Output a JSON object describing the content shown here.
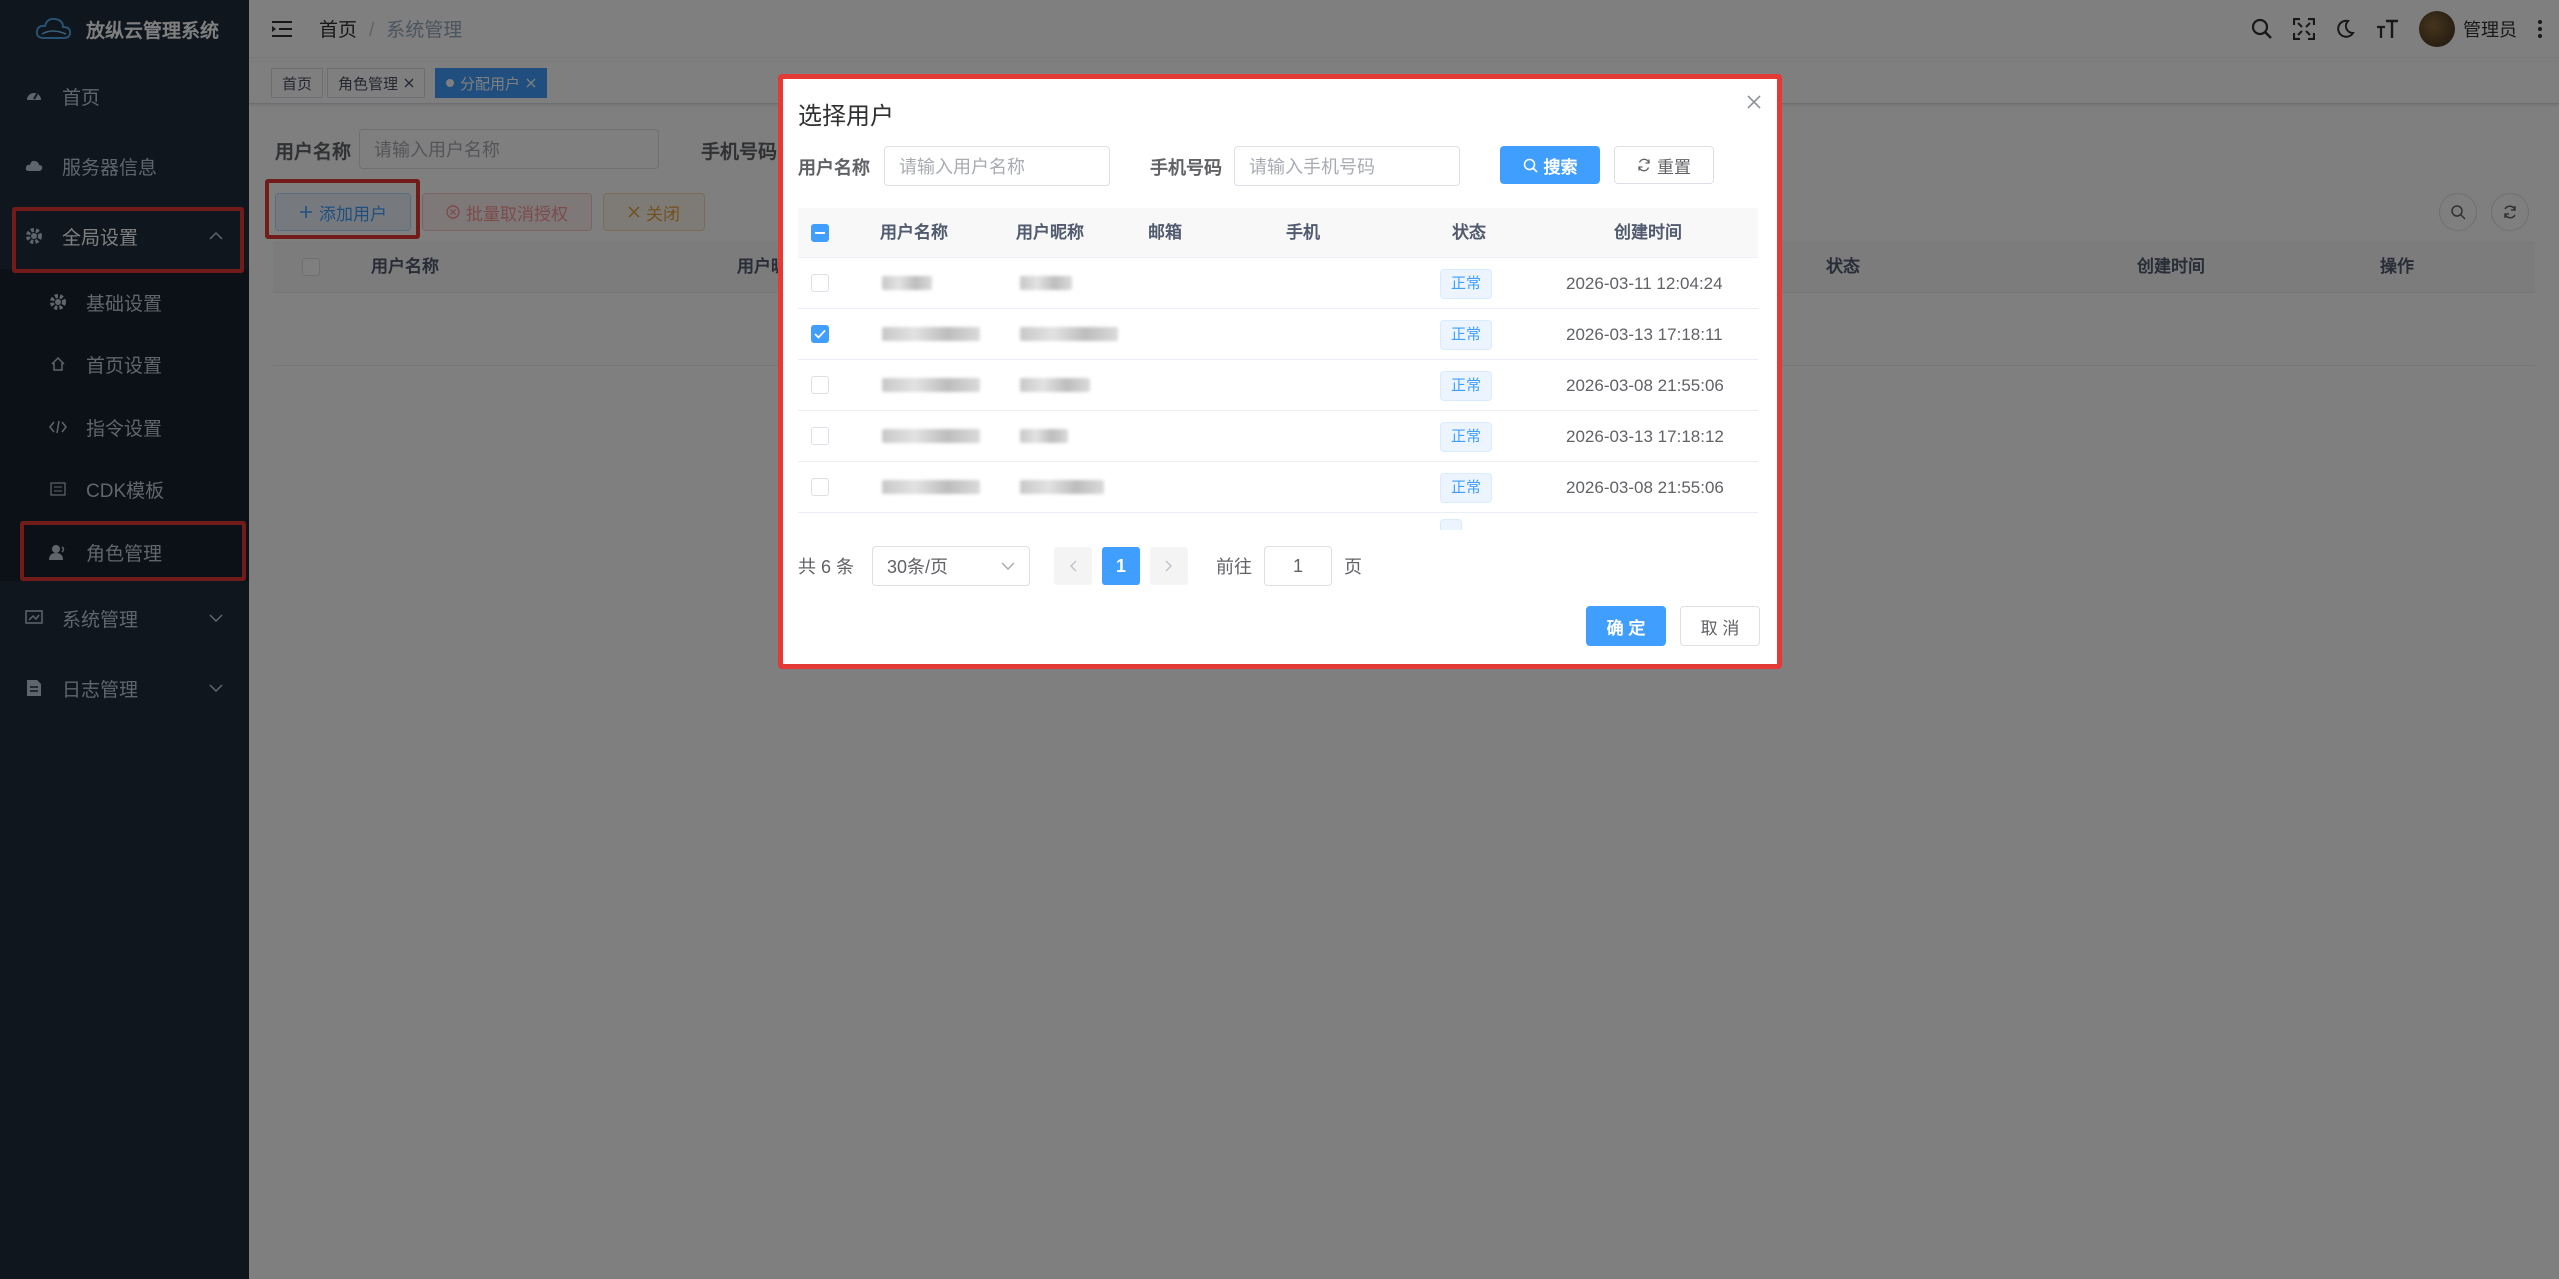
{
  "app": {
    "title": "放纵云管理系统"
  },
  "sidebar": {
    "items": [
      {
        "label": "首页"
      },
      {
        "label": "服务器信息"
      },
      {
        "label": "全局设置"
      },
      {
        "label": "基础设置"
      },
      {
        "label": "首页设置"
      },
      {
        "label": "指令设置"
      },
      {
        "label": "CDK模板"
      },
      {
        "label": "角色管理"
      },
      {
        "label": "系统管理"
      },
      {
        "label": "日志管理"
      }
    ]
  },
  "navbar": {
    "breadcrumb": [
      "首页",
      "系统管理"
    ],
    "separator": "/",
    "user": "管理员"
  },
  "tags": [
    {
      "label": "首页"
    },
    {
      "label": "角色管理"
    },
    {
      "label": "分配用户"
    }
  ],
  "page": {
    "search": {
      "username_label": "用户名称",
      "username_placeholder": "请输入用户名称",
      "phone_label": "手机号码"
    },
    "toolbar": {
      "add_user": "添加用户",
      "batch_cancel": "批量取消授权",
      "close": "关闭"
    },
    "table": {
      "columns": [
        "用户名称",
        "用户昵称",
        "状态",
        "创建时间",
        "操作"
      ]
    }
  },
  "dialog": {
    "title": "选择用户",
    "search": {
      "username_label": "用户名称",
      "username_placeholder": "请输入用户名称",
      "phone_label": "手机号码",
      "phone_placeholder": "请输入手机号码",
      "search_button": "搜索",
      "reset_button": "重置"
    },
    "table": {
      "columns": [
        "用户名称",
        "用户昵称",
        "邮箱",
        "手机",
        "状态",
        "创建时间"
      ],
      "rows": [
        {
          "checked": false,
          "status": "正常",
          "created": "2026-03-11 12:04:24"
        },
        {
          "checked": true,
          "status": "正常",
          "created": "2026-03-13 17:18:11"
        },
        {
          "checked": false,
          "status": "正常",
          "created": "2026-03-08 21:55:06"
        },
        {
          "checked": false,
          "status": "正常",
          "created": "2026-03-13 17:18:12"
        },
        {
          "checked": false,
          "status": "正常",
          "created": "2026-03-08 21:55:06"
        }
      ]
    },
    "pagination": {
      "total": "共 6 条",
      "page_size": "30条/页",
      "current": "1",
      "goto_label": "前往",
      "goto_value": "1",
      "page_suffix": "页"
    },
    "confirm": "确 定",
    "cancel": "取 消"
  },
  "colors": {
    "primary": "#409eff",
    "sidebar": "#1f2d3d",
    "highlight": "#e53935"
  }
}
